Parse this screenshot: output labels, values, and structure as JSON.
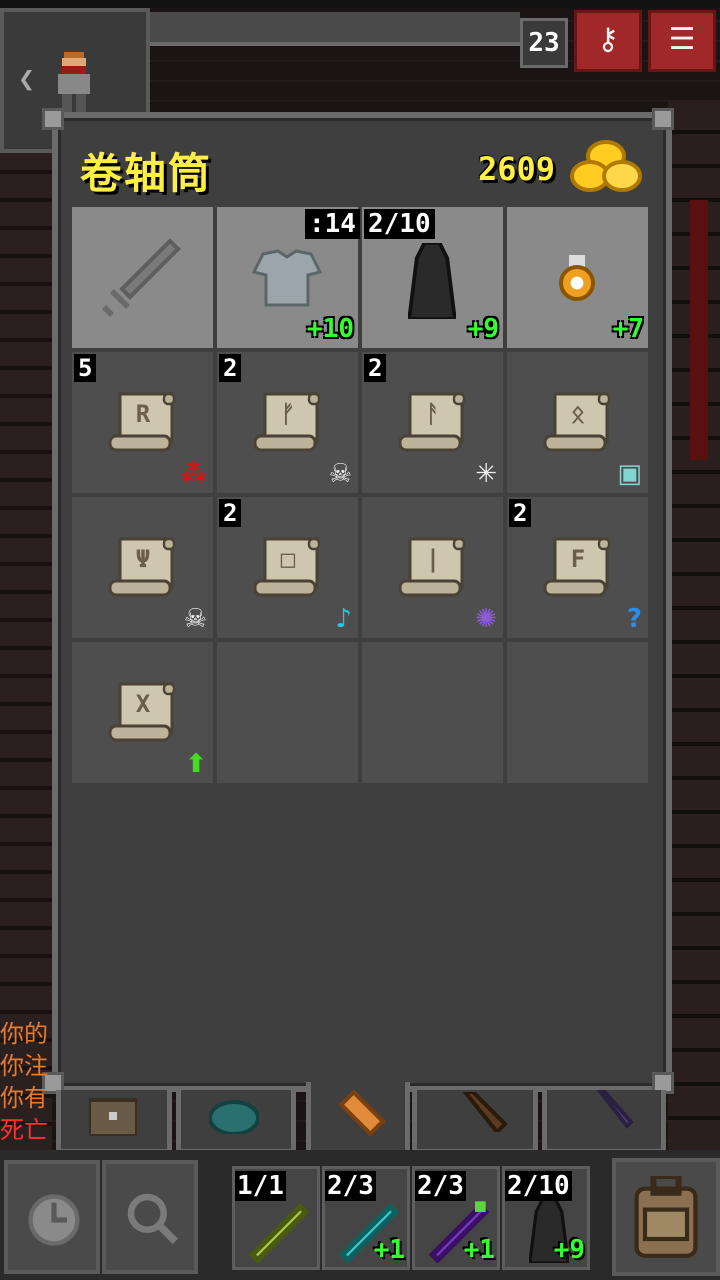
{
  "window": {
    "title": "卷轴筒",
    "gold": "2609"
  },
  "hud": {
    "depth": "23",
    "journal_icon": "key-icon",
    "menu_icon": "menu-icon",
    "back_icon": "back-arrow-icon"
  },
  "equipped": [
    {
      "icon": "sword-placeholder-icon",
      "top": "",
      "level": ""
    },
    {
      "icon": "chainmail-icon",
      "top": ":14",
      "level": "+10"
    },
    {
      "icon": "cloak-icon",
      "top": "2/10",
      "level": "+9"
    },
    {
      "icon": "amulet-icon",
      "top": "",
      "level": "+7"
    }
  ],
  "scrolls": [
    {
      "rune": "R",
      "qty": "5",
      "badge_icon": "rage-icon",
      "badge_text": "⁂",
      "badge_color": "#d01818"
    },
    {
      "rune": "ᚠ",
      "qty": "2",
      "badge_icon": "skull-icon",
      "badge_text": "☠",
      "badge_color": "#f0f0f0"
    },
    {
      "rune": "ᚨ",
      "qty": "2",
      "badge_icon": "sparkle-icon",
      "badge_text": "✳",
      "badge_color": "#f0f0f0"
    },
    {
      "rune": "ᛟ",
      "qty": "",
      "badge_icon": "mapping-icon",
      "badge_text": "▣",
      "badge_color": "#7fd8d0"
    },
    {
      "rune": "Ψ",
      "qty": "",
      "badge_icon": "skull-icon",
      "badge_text": "☠",
      "badge_color": "#f0f0f0"
    },
    {
      "rune": "□",
      "qty": "2",
      "badge_icon": "music-note-icon",
      "badge_text": "♪",
      "badge_color": "#22c8e0"
    },
    {
      "rune": "|",
      "qty": "",
      "badge_icon": "vortex-icon",
      "badge_text": "✺",
      "badge_color": "#8a5cd8"
    },
    {
      "rune": "F",
      "qty": "2",
      "badge_icon": "question-icon",
      "badge_text": "?",
      "badge_color": "#2a8cf0"
    },
    {
      "rune": "X",
      "qty": "",
      "badge_icon": "upgrade-arrow-icon",
      "badge_text": "⬆",
      "badge_color": "#44dd22"
    }
  ],
  "log": [
    {
      "text": "你的",
      "color": "#e87a2a"
    },
    {
      "text": "你注",
      "color": "#e87a2a"
    },
    {
      "text": "你有",
      "color": "#e87a2a"
    },
    {
      "text": "死亡",
      "color": "#ff3030"
    }
  ],
  "quickslots": [
    {
      "top": "1/1",
      "level": "",
      "icon": "wand-green-icon"
    },
    {
      "top": "2/3",
      "level": "+1",
      "icon": "wand-cyan-icon"
    },
    {
      "top": "2/3",
      "level": "+1",
      "icon": "wand-purple-icon"
    },
    {
      "top": "2/10",
      "level": "+9",
      "icon": "cloak-icon"
    }
  ],
  "tabs": [
    {
      "icon": "chest-icon"
    },
    {
      "icon": "seed-pouch-icon"
    },
    {
      "icon": "scroll-holder-icon"
    },
    {
      "icon": "wand-holster-icon"
    },
    {
      "icon": "magic-wand-icon"
    }
  ]
}
